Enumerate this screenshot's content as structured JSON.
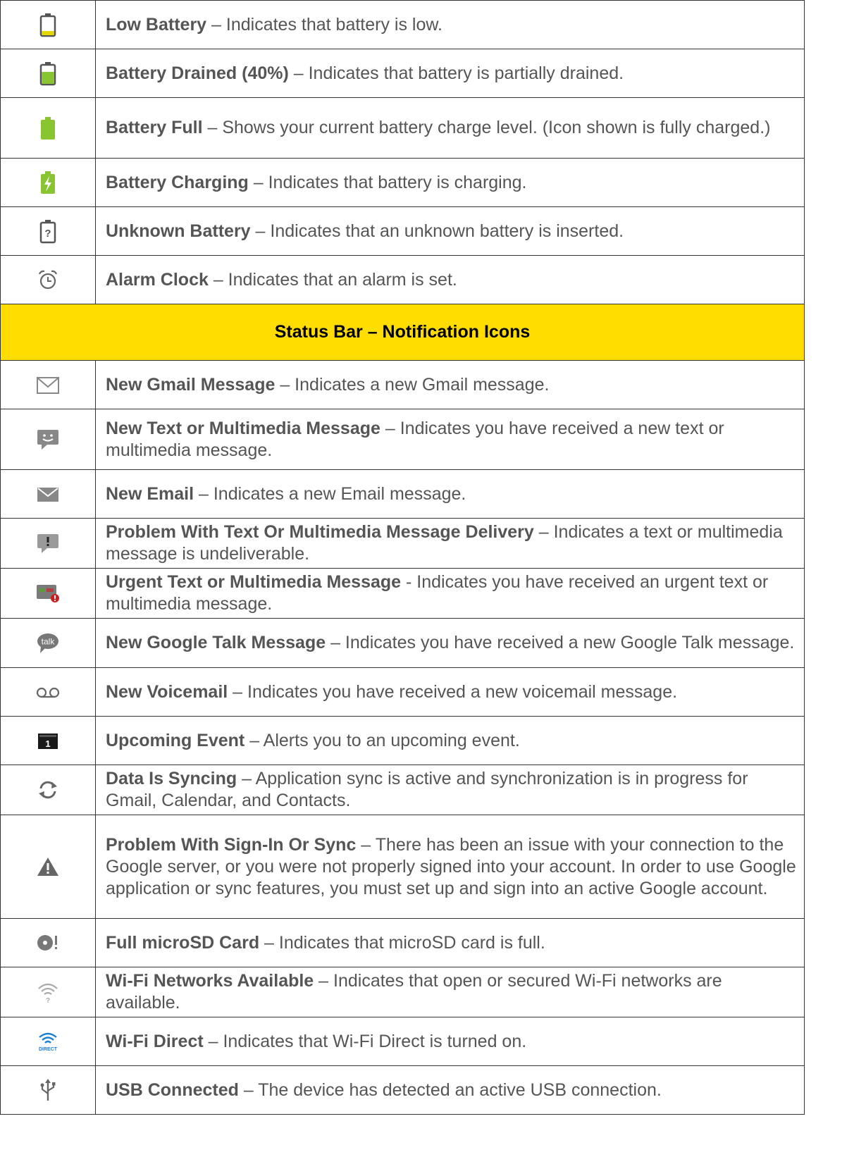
{
  "section_header": "Status Bar – Notification Icons",
  "battery_rows": [
    {
      "icon": "low-battery-icon",
      "label": "Low Battery",
      "text": " – Indicates that battery is low."
    },
    {
      "icon": "battery-drained-icon",
      "label": "Battery Drained (40%)",
      "text": " – Indicates that battery is partially drained."
    },
    {
      "icon": "battery-full-icon",
      "label": "Battery Full",
      "text": " – Shows your current battery charge level. (Icon shown is fully charged.)"
    },
    {
      "icon": "battery-charging-icon",
      "label": "Battery Charging",
      "text": " – Indicates that battery is charging."
    },
    {
      "icon": "unknown-battery-icon",
      "label": "Unknown Battery",
      "text": " – Indicates that an unknown battery is inserted."
    },
    {
      "icon": "alarm-clock-icon",
      "label": "Alarm Clock",
      "text": " – Indicates that an alarm is set."
    }
  ],
  "notification_rows": [
    {
      "icon": "gmail-icon",
      "label": "New Gmail Message",
      "text": " – Indicates a new Gmail message."
    },
    {
      "icon": "text-message-icon",
      "label": "New Text or Multimedia Message",
      "text": " – Indicates you have received a new text or multimedia message."
    },
    {
      "icon": "email-icon",
      "label": "New Email",
      "text": " – Indicates a new Email message."
    },
    {
      "icon": "message-delivery-problem-icon",
      "label": "Problem With Text Or Multimedia Message Delivery",
      "text": " – Indicates a text or multimedia message is undeliverable."
    },
    {
      "icon": "urgent-message-icon",
      "label": "Urgent Text or Multimedia Message",
      "text": " - Indicates you have received an urgent text or multimedia message."
    },
    {
      "icon": "google-talk-icon",
      "label": "New Google Talk Message",
      "text": " – Indicates you have received a new Google Talk message."
    },
    {
      "icon": "voicemail-icon",
      "label": "New Voicemail",
      "text": " – Indicates you have received a new voicemail message."
    },
    {
      "icon": "upcoming-event-icon",
      "label": "Upcoming Event",
      "text": " – Alerts you to an upcoming event."
    },
    {
      "icon": "sync-icon",
      "label": "Data Is Syncing",
      "text": " – Application sync is active and synchronization is in progress for Gmail, Calendar, and Contacts."
    },
    {
      "icon": "warning-icon",
      "label": "Problem With Sign-In Or Sync",
      "text": " – There has been an issue with your connection to the Google server, or you were not properly signed into your account. In order to use Google application or sync features, you must set up and sign into an active Google account."
    },
    {
      "icon": "sd-card-full-icon",
      "label": "Full microSD Card",
      "text": " – Indicates that microSD card is full."
    },
    {
      "icon": "wifi-available-icon",
      "label": "Wi-Fi Networks Available",
      "text": " – Indicates that open or secured Wi-Fi networks are available."
    },
    {
      "icon": "wifi-direct-icon",
      "label": "Wi-Fi Direct",
      "text": " – Indicates that Wi-Fi Direct is turned on.",
      "icon_text": "DIRECT"
    },
    {
      "icon": "usb-icon",
      "label": "USB Connected",
      "text": " – The device has detected an active USB connection."
    }
  ],
  "colors": {
    "section_bg": "#ffdd00",
    "battery_green": "#88c530",
    "battery_yellow": "#e2d800",
    "text": "#555555"
  }
}
